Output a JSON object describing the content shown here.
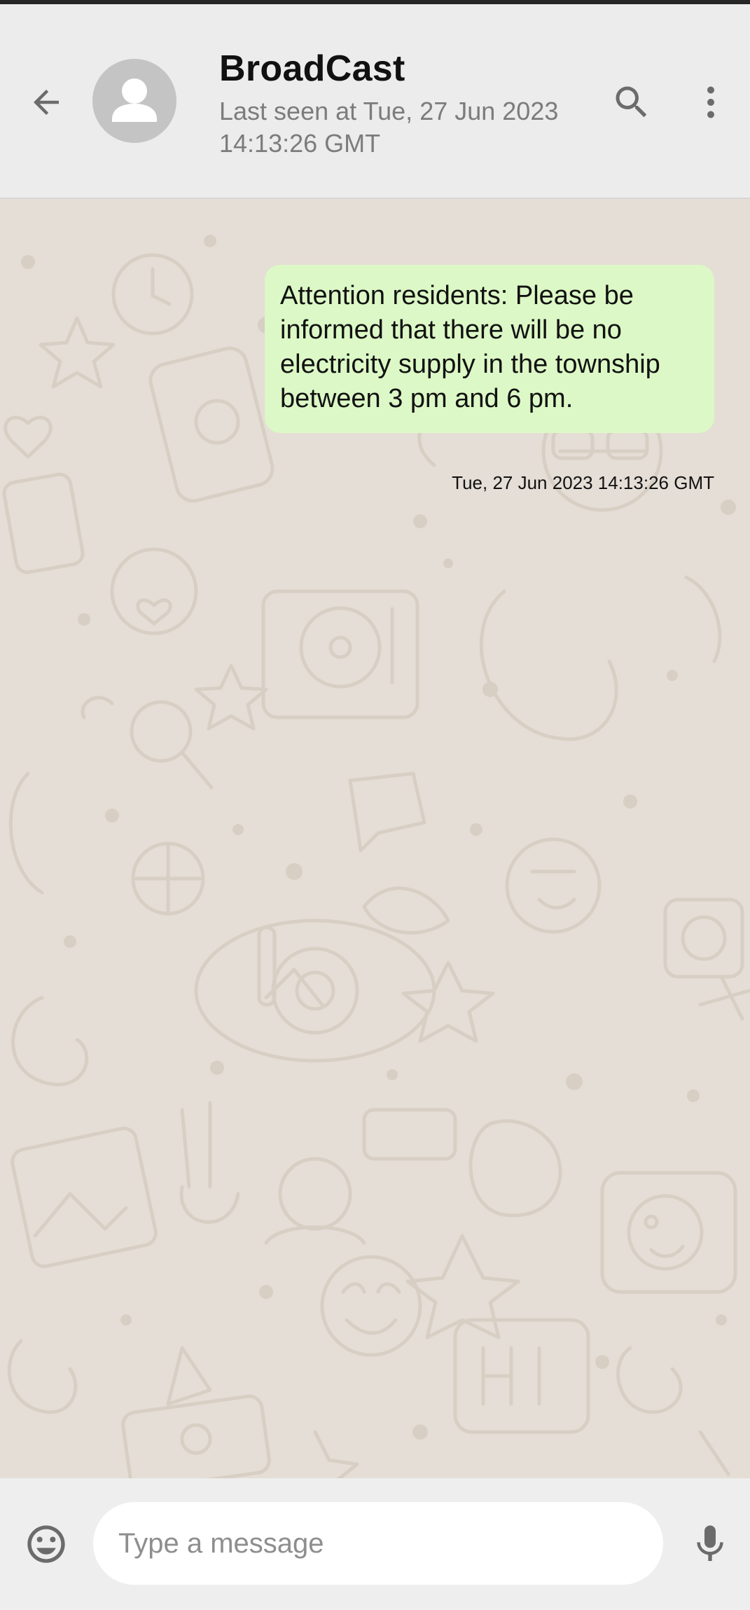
{
  "header": {
    "contact_name": "BroadCast",
    "last_seen": "Last seen at Tue, 27 Jun 2023 14:13:26 GMT",
    "icons": {
      "back": "arrow-back-icon",
      "avatar": "person-icon",
      "search": "search-icon",
      "more": "more-vertical-icon"
    }
  },
  "messages": [
    {
      "text": "Attention residents: Please be informed that there will be no electricity supply in the township between 3 pm and 6 pm.",
      "timestamp": "Tue, 27 Jun 2023 14:13:26 GMT",
      "direction": "outgoing"
    }
  ],
  "composer": {
    "placeholder": "Type a message",
    "value": "",
    "icons": {
      "emoji": "emoji-icon",
      "mic": "mic-icon"
    }
  },
  "colors": {
    "header_bg": "#ececec",
    "chat_bg": "#e5ded6",
    "bubble_bg": "#dcf8c6",
    "icon_gray": "#6b6b6b",
    "avatar_bg": "#c4c4c4"
  }
}
